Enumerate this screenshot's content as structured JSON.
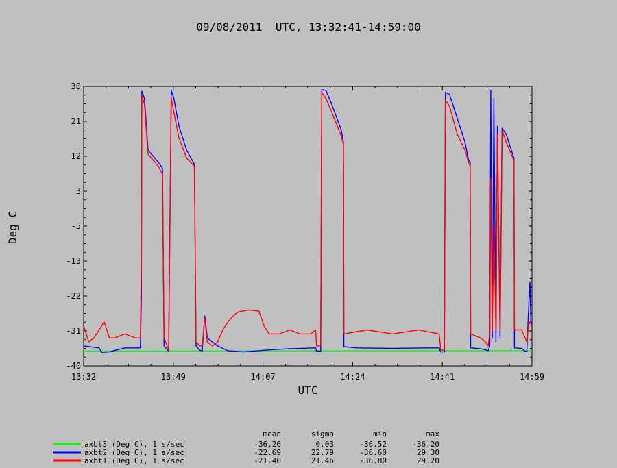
{
  "chart_data": {
    "type": "line",
    "title": "09/08/2011  UTC, 13:32:41-14:59:00",
    "xlabel": "UTC",
    "ylabel": "Deg C",
    "ylim": [
      -40,
      30
    ],
    "x_range_minutes": [
      0,
      87
    ],
    "yticks": [
      "30",
      "21",
      "12",
      "3",
      "-5",
      "-13",
      "-22",
      "-31",
      "-40"
    ],
    "xticks": [
      "13:32",
      "13:49",
      "14:07",
      "14:24",
      "14:41",
      "14:59"
    ],
    "grid": false,
    "legend_position": "bottom-left",
    "stats_headers": [
      "mean",
      "sigma",
      "min",
      "max"
    ],
    "series": [
      {
        "name": "axbt3 (Deg C), 1 s/sec",
        "color": "#00ff00",
        "stats": [
          "-36.26",
          "0.03",
          "-36.52",
          "-36.20"
        ],
        "points": [
          [
            0,
            -36.3
          ],
          [
            87,
            -36.2
          ]
        ]
      },
      {
        "name": "axbt2 (Deg C), 1 s/sec",
        "color": "#0000ff",
        "stats": [
          "-22.69",
          "22.79",
          "-36.60",
          "29.30"
        ],
        "points": [
          [
            0,
            -35
          ],
          [
            3,
            -35.5
          ],
          [
            3.5,
            -36.6
          ],
          [
            5,
            -36.5
          ],
          [
            8,
            -35.5
          ],
          [
            11,
            -35.5
          ],
          [
            11.2,
            -23
          ],
          [
            11.3,
            28.8
          ],
          [
            11.8,
            27
          ],
          [
            12.5,
            14
          ],
          [
            14.5,
            11
          ],
          [
            15.3,
            9.5
          ],
          [
            15.6,
            -35
          ],
          [
            16.5,
            -36.3
          ],
          [
            17,
            29
          ],
          [
            17.5,
            27
          ],
          [
            18.5,
            20
          ],
          [
            20,
            14
          ],
          [
            21.5,
            10.5
          ],
          [
            21.8,
            -35
          ],
          [
            22.5,
            -36
          ],
          [
            23,
            -36.3
          ],
          [
            23.5,
            -27.5
          ],
          [
            24,
            -33
          ],
          [
            26,
            -35
          ],
          [
            28,
            -36.2
          ],
          [
            31,
            -36.5
          ],
          [
            36,
            -36
          ],
          [
            40,
            -35.7
          ],
          [
            45,
            -35.5
          ],
          [
            45.2,
            -36.3
          ],
          [
            46,
            -36.3
          ],
          [
            46.2,
            29.2
          ],
          [
            47,
            29
          ],
          [
            48,
            26
          ],
          [
            50,
            19
          ],
          [
            50.4,
            16
          ],
          [
            50.5,
            -35.2
          ],
          [
            53,
            -35.5
          ],
          [
            60,
            -35.6
          ],
          [
            67,
            -35.5
          ],
          [
            69,
            -35.5
          ],
          [
            69.3,
            -36.5
          ],
          [
            70,
            -36.5
          ],
          [
            70.2,
            28.5
          ],
          [
            71,
            28
          ],
          [
            72.5,
            22
          ],
          [
            74,
            16
          ],
          [
            74.7,
            11.5
          ],
          [
            75,
            11
          ],
          [
            75.1,
            -35.5
          ],
          [
            77,
            -35.7
          ],
          [
            78,
            -36
          ],
          [
            78.5,
            -36.2
          ],
          [
            78.8,
            -35
          ],
          [
            79,
            29
          ],
          [
            79.3,
            -33
          ],
          [
            79.6,
            27
          ],
          [
            80,
            -34
          ],
          [
            80.3,
            20
          ],
          [
            80.8,
            -33
          ],
          [
            81.2,
            19.5
          ],
          [
            82,
            18
          ],
          [
            83,
            14
          ],
          [
            83.5,
            12
          ],
          [
            83.6,
            -35.5
          ],
          [
            85,
            -35.6
          ],
          [
            85.5,
            -36.2
          ],
          [
            86,
            -36.4
          ],
          [
            86.3,
            -27
          ],
          [
            86.6,
            -19
          ],
          [
            86.8,
            -30
          ],
          [
            87,
            -30
          ]
        ]
      },
      {
        "name": "axbt1 (Deg C), 1 s/sec",
        "color": "#ff0000",
        "stats": [
          "-21.40",
          "21.46",
          "-36.80",
          "29.20"
        ],
        "points": [
          [
            0,
            -30
          ],
          [
            1,
            -34
          ],
          [
            2,
            -33
          ],
          [
            3,
            -31
          ],
          [
            4,
            -29
          ],
          [
            5,
            -33
          ],
          [
            6,
            -33
          ],
          [
            8,
            -32
          ],
          [
            10,
            -33
          ],
          [
            11,
            -33
          ],
          [
            11.2,
            -15
          ],
          [
            11.3,
            28
          ],
          [
            11.8,
            25.5
          ],
          [
            12.5,
            13
          ],
          [
            14.5,
            10
          ],
          [
            15.3,
            8
          ],
          [
            15.6,
            -33
          ],
          [
            16.5,
            -36
          ],
          [
            17,
            27
          ],
          [
            17.5,
            23.5
          ],
          [
            18.5,
            17
          ],
          [
            20,
            12
          ],
          [
            21.5,
            10
          ],
          [
            21.8,
            -34
          ],
          [
            22.5,
            -35
          ],
          [
            23,
            -35
          ],
          [
            23.5,
            -28
          ],
          [
            24,
            -34
          ],
          [
            25,
            -35
          ],
          [
            26,
            -34
          ],
          [
            27,
            -31
          ],
          [
            28,
            -29
          ],
          [
            29,
            -27.5
          ],
          [
            30,
            -26.5
          ],
          [
            32,
            -26
          ],
          [
            34,
            -26.3
          ],
          [
            34.5,
            -28
          ],
          [
            35,
            -30
          ],
          [
            35.5,
            -31
          ],
          [
            36,
            -32
          ],
          [
            38,
            -32
          ],
          [
            40,
            -31
          ],
          [
            42,
            -32
          ],
          [
            44,
            -32
          ],
          [
            45,
            -31
          ],
          [
            45.2,
            -35
          ],
          [
            46,
            -35
          ],
          [
            46.2,
            28.5
          ],
          [
            47,
            27
          ],
          [
            48,
            24
          ],
          [
            50,
            17.5
          ],
          [
            50.4,
            15.5
          ],
          [
            50.5,
            -32
          ],
          [
            55,
            -31
          ],
          [
            60,
            -32
          ],
          [
            65,
            -31
          ],
          [
            69,
            -32
          ],
          [
            69.3,
            -36
          ],
          [
            70,
            -36
          ],
          [
            70.2,
            26.5
          ],
          [
            71,
            25
          ],
          [
            72.5,
            18
          ],
          [
            74,
            14
          ],
          [
            74.7,
            11
          ],
          [
            75,
            10
          ],
          [
            75.1,
            -32
          ],
          [
            77,
            -33
          ],
          [
            78,
            -34
          ],
          [
            78.5,
            -35
          ],
          [
            78.8,
            -32
          ],
          [
            79,
            7
          ],
          [
            79.3,
            -31
          ],
          [
            79.6,
            -5
          ],
          [
            80,
            -31
          ],
          [
            80.3,
            18
          ],
          [
            80.8,
            -31
          ],
          [
            81.2,
            19
          ],
          [
            82,
            16
          ],
          [
            83,
            13
          ],
          [
            83.5,
            11.5
          ],
          [
            83.6,
            -31
          ],
          [
            85,
            -31
          ],
          [
            86,
            -34
          ],
          [
            86.3,
            -30
          ],
          [
            86.6,
            -29
          ],
          [
            87,
            -30
          ]
        ]
      }
    ]
  }
}
